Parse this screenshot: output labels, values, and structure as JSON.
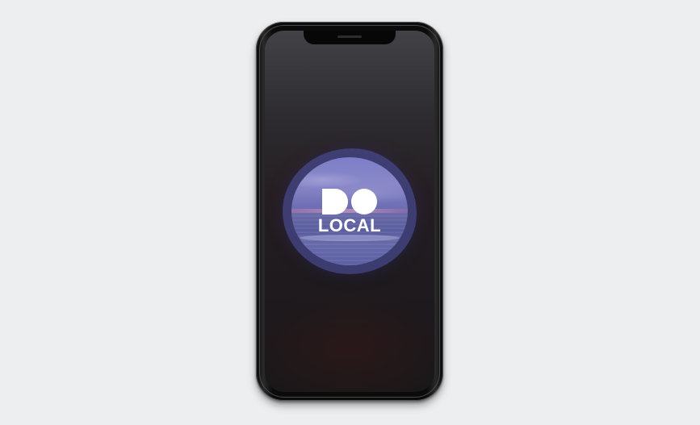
{
  "device": {
    "model": "smartphone",
    "frame_color": "#0b0b0b",
    "page_background": "#edeef0"
  },
  "splash": {
    "logo_mark_icon": "do-logo-icon",
    "logo_text": "LOCAL",
    "logo_text_color": "#ffffff",
    "ring_color": "#4a4c8c",
    "background_image": "ocean-sunset-photo"
  }
}
